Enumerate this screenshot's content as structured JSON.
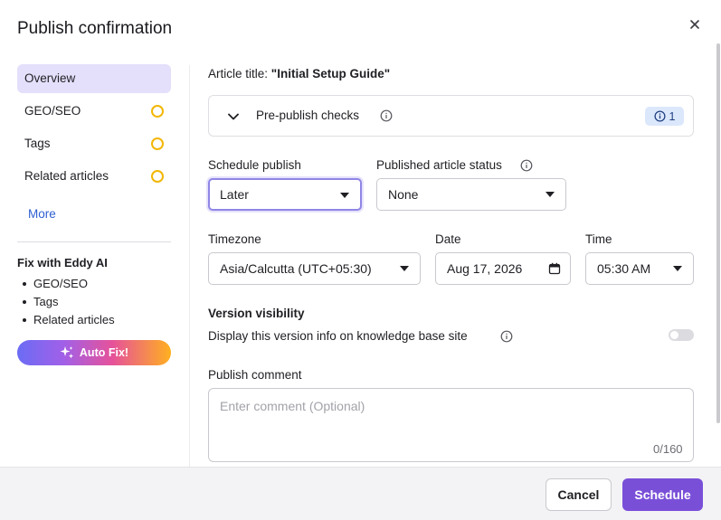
{
  "dialog": {
    "title": "Publish confirmation",
    "close_icon": "close-icon"
  },
  "sidebar": {
    "items": [
      {
        "label": "Overview",
        "active": true,
        "status": ""
      },
      {
        "label": "GEO/SEO",
        "active": false,
        "status": "pending"
      },
      {
        "label": "Tags",
        "active": false,
        "status": "pending"
      },
      {
        "label": "Related articles",
        "active": false,
        "status": "pending"
      }
    ],
    "more_label": "More",
    "eddy": {
      "title": "Fix with Eddy AI",
      "items": [
        "GEO/SEO",
        "Tags",
        "Related articles"
      ],
      "button_label": "Auto Fix!",
      "button_icon": "sparkle-icon"
    }
  },
  "main": {
    "article_title_label": "Article title:",
    "article_title_value": "\"Initial Setup Guide\"",
    "prepublish": {
      "label": "Pre-publish checks",
      "badge_count": "1"
    },
    "schedule_publish": {
      "label": "Schedule publish",
      "value": "Later"
    },
    "published_status": {
      "label": "Published article status",
      "value": "None"
    },
    "timezone": {
      "label": "Timezone",
      "value": "Asia/Calcutta (UTC+05:30)"
    },
    "date": {
      "label": "Date",
      "value": "Aug 17, 2026"
    },
    "time": {
      "label": "Time",
      "value": "05:30 AM"
    },
    "version_visibility": {
      "title": "Version visibility",
      "description": "Display this version info on knowledge base site",
      "enabled": false
    },
    "comment": {
      "label": "Publish comment",
      "placeholder": "Enter comment (Optional)",
      "counter": "0/160"
    }
  },
  "footer": {
    "cancel_label": "Cancel",
    "schedule_label": "Schedule"
  },
  "colors": {
    "accent": "#7a4fd8",
    "active_nav": "#e4e0fb",
    "pending_dot": "#f2b705",
    "link": "#2e5fd1"
  }
}
